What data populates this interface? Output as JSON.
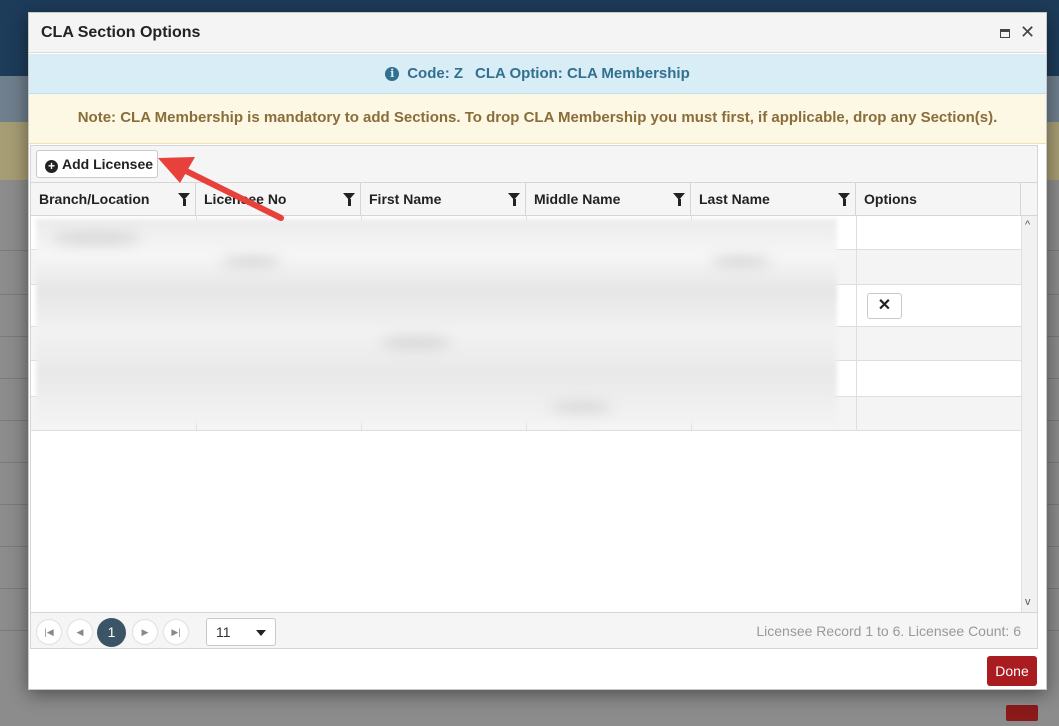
{
  "modal": {
    "title": "CLA Section Options",
    "info": {
      "code": "Code: Z",
      "option": "CLA Option: CLA Membership"
    },
    "note": "Note: CLA Membership is mandatory to add Sections. To drop CLA Membership you must first, if applicable, drop any Section(s).",
    "toolbar": {
      "add_label": "Add Licensee"
    },
    "columns": [
      "Branch/Location",
      "Licensee No",
      "First Name",
      "Middle Name",
      "Last Name",
      "Options"
    ],
    "row_count": 6,
    "remove_label": "✕",
    "pager": {
      "current_page": "1",
      "page_size": "11",
      "info": "Licensee Record 1 to 6. Licensee Count: 6"
    },
    "done_label": "Done"
  },
  "colors": {
    "info_text": "#31708f",
    "warning_text": "#8a6d3b",
    "done_button": "#a91c20",
    "annotation_arrow": "#e8403a"
  },
  "icons": [
    "info-icon",
    "plus-circle-icon",
    "filter-icon",
    "close-icon",
    "maximize-icon",
    "first-page-icon",
    "prev-page-icon",
    "next-page-icon",
    "last-page-icon",
    "chevron-down-icon"
  ]
}
